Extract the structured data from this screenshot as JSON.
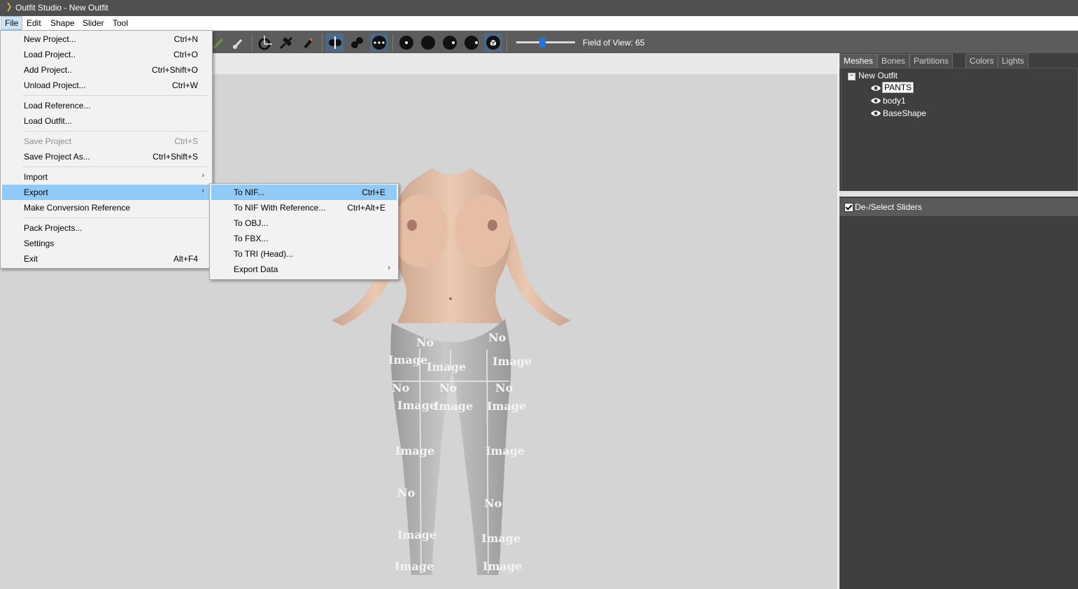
{
  "window": {
    "title": "Outfit Studio - New Outfit"
  },
  "menubar": {
    "items": [
      "File",
      "Edit",
      "Shape",
      "Slider",
      "Tool"
    ]
  },
  "toolbar": {
    "fov_label": "Field of View: 65",
    "fov_value": 65
  },
  "file_menu": {
    "items": [
      {
        "label": "New Project...",
        "shortcut": "Ctrl+N"
      },
      {
        "label": "Load Project..",
        "shortcut": "Ctrl+O"
      },
      {
        "label": "Add Project..",
        "shortcut": "Ctrl+Shift+O"
      },
      {
        "label": "Unload Project...",
        "shortcut": "Ctrl+W"
      },
      {
        "label": "Load Reference...",
        "shortcut": ""
      },
      {
        "label": "Load Outfit...",
        "shortcut": ""
      },
      {
        "label": "Save Project",
        "shortcut": "Ctrl+S"
      },
      {
        "label": "Save Project As...",
        "shortcut": "Ctrl+Shift+S"
      },
      {
        "label": "Import",
        "shortcut": ""
      },
      {
        "label": "Export",
        "shortcut": ""
      },
      {
        "label": "Make Conversion Reference",
        "shortcut": ""
      },
      {
        "label": "Pack Projects...",
        "shortcut": ""
      },
      {
        "label": "Settings",
        "shortcut": ""
      },
      {
        "label": "Exit",
        "shortcut": "Alt+F4"
      }
    ]
  },
  "export_menu": {
    "items": [
      {
        "label": "To NIF...",
        "shortcut": "Ctrl+E"
      },
      {
        "label": "To NIF With Reference...",
        "shortcut": "Ctrl+Alt+E"
      },
      {
        "label": "To OBJ...",
        "shortcut": ""
      },
      {
        "label": "To FBX...",
        "shortcut": ""
      },
      {
        "label": "To TRI (Head)...",
        "shortcut": ""
      },
      {
        "label": "Export Data",
        "shortcut": ""
      }
    ]
  },
  "panel": {
    "tabs": [
      "Meshes",
      "Bones",
      "Partitions",
      "Colors",
      "Lights"
    ],
    "tree_root": "New Outfit",
    "meshes": [
      "PANTS",
      "body1",
      "BaseShape"
    ],
    "sliders_toggle": "De-/Select Sliders"
  },
  "texture_text": {
    "no": "No",
    "image": "Image"
  },
  "colors": {
    "highlight": "#91c9f7",
    "toolbar": "#5c5c5c",
    "panel": "#3f3f3f",
    "slider_thumb": "#1e73e0"
  }
}
